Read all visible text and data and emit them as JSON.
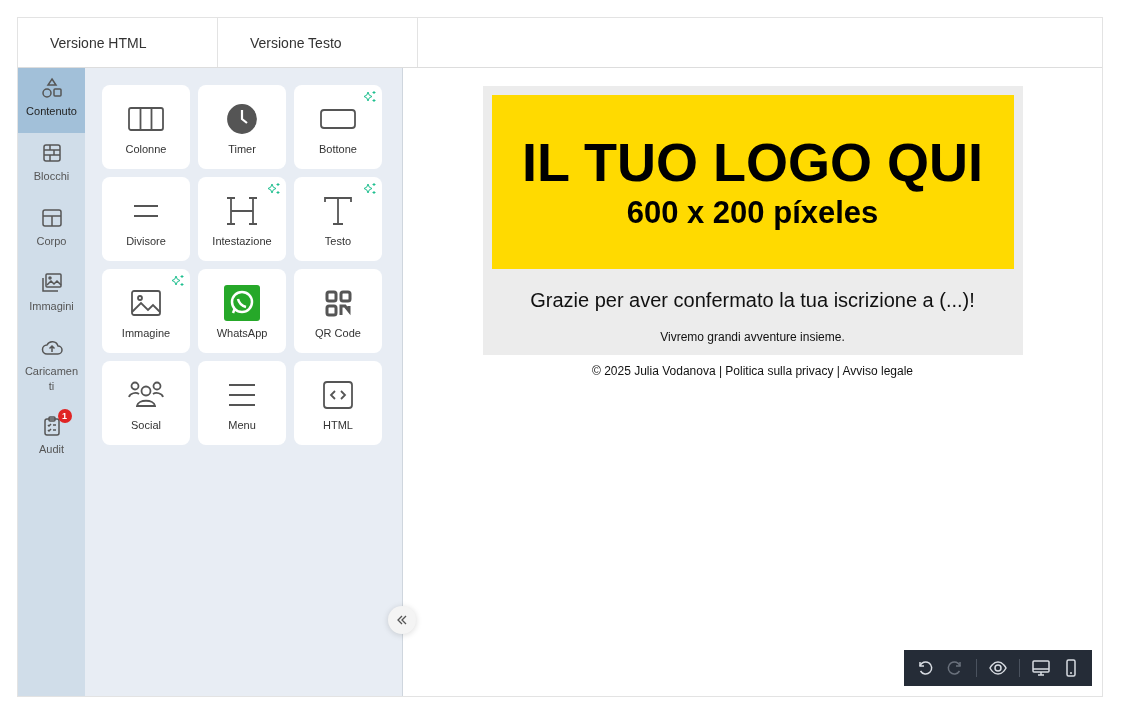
{
  "tabs": [
    {
      "label": "Versione HTML",
      "selected": false
    },
    {
      "label": "Versione Testo",
      "selected": false
    }
  ],
  "sidebar": {
    "items": [
      {
        "label": "Contenuto",
        "selected": true
      },
      {
        "label": "Blocchi",
        "selected": false
      },
      {
        "label": "Corpo",
        "selected": false
      },
      {
        "label": "Immagini",
        "selected": false
      },
      {
        "label": "Caricamenti",
        "selected": false
      },
      {
        "label": "Audit",
        "selected": false,
        "badge": "1"
      }
    ]
  },
  "blocks": [
    {
      "label": "Colonne",
      "ai": false
    },
    {
      "label": "Timer",
      "ai": false
    },
    {
      "label": "Bottone",
      "ai": true
    },
    {
      "label": "Divisore",
      "ai": false
    },
    {
      "label": "Intestazione",
      "ai": true
    },
    {
      "label": "Testo",
      "ai": true
    },
    {
      "label": "Immagine",
      "ai": true
    },
    {
      "label": "WhatsApp",
      "ai": false
    },
    {
      "label": "QR Code",
      "ai": false
    },
    {
      "label": "Social",
      "ai": false
    },
    {
      "label": "Menu",
      "ai": false
    },
    {
      "label": "HTML",
      "ai": false
    }
  ],
  "email": {
    "logo_title": "IL TUO LOGO QUI",
    "logo_subtitle": "600 x 200 píxeles",
    "heading": "Grazie per aver confermato la tua iscrizione a (...)!",
    "tagline": "Vivremo grandi avventure insieme.",
    "footer": "© 2025 Julia Vodanova | Politica sulla privacy | Avviso legale"
  },
  "toolbar": [
    {
      "disabled": false
    },
    {
      "disabled": true
    },
    {
      "disabled": false
    },
    {
      "disabled": false
    },
    {
      "disabled": false
    }
  ]
}
